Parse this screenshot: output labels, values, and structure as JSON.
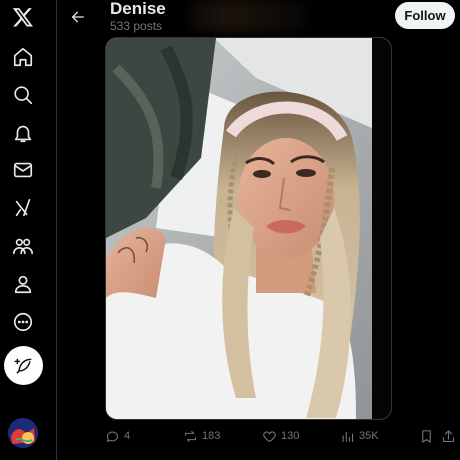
{
  "header": {
    "name": "Denise",
    "post_count": "533 posts",
    "follow_label": "Follow"
  },
  "sidebar": {
    "items": [
      {
        "icon": "x-logo-icon"
      },
      {
        "icon": "home-icon"
      },
      {
        "icon": "search-icon"
      },
      {
        "icon": "bell-icon"
      },
      {
        "icon": "mail-icon"
      },
      {
        "icon": "grok-icon"
      },
      {
        "icon": "communities-icon"
      },
      {
        "icon": "profile-icon"
      },
      {
        "icon": "more-icon"
      }
    ],
    "post_button_icon": "feather-plus-icon"
  },
  "tweet": {
    "replies": "4",
    "reposts": "183",
    "likes": "130",
    "views": "35K"
  },
  "colors": {
    "background": "#000000",
    "text": "#e7e9ea",
    "muted": "#71767b",
    "border": "#2f3336"
  }
}
